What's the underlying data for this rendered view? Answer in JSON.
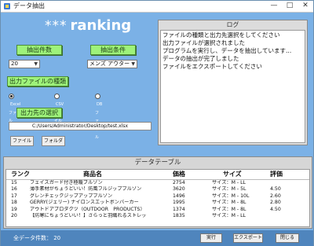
{
  "window": {
    "title": "データ抽出",
    "minimize": "—",
    "maximize": "□",
    "close": "✕"
  },
  "heading": {
    "stars": "***",
    "word": "ranking"
  },
  "extract": {
    "count_label": "抽出件数",
    "condition_label": "抽出条件",
    "count_value": "20",
    "condition_value": "メンズ アウター"
  },
  "output": {
    "type_label": "出力ファイルの種類",
    "options": [
      "Excelファイル",
      "CSVファイル",
      "DBファイル"
    ],
    "selected": 0,
    "dest_label": "出力先の選択",
    "path": "C:/Users/Administrator/Desktop/test.xlsx",
    "file_button": "ファイル",
    "folder_button": "フォルダ"
  },
  "log": {
    "title": "ログ",
    "lines": [
      "ファイルの種類と出力先選択をしてください",
      "出力ファイルが選択されました",
      "プログラムを実行し、データを抽出しています...",
      "データの抽出が完了しました",
      "ファイルをエクスポートしてください"
    ]
  },
  "table": {
    "title": "データテーブル",
    "headers": [
      "ランク",
      "商品名",
      "価格",
      "サイズ",
      "評価"
    ],
    "rows": [
      [
        "15",
        "フェイスガード付き極暖ブルゾン",
        "2754",
        "サイズ：M - LL",
        ""
      ],
      [
        "16",
        "薄手素材がちょうどいい！防風フルジップブルゾン",
        "3620",
        "サイズ：M - 5L",
        "4.50"
      ],
      [
        "17",
        "グレンチェックジップアップブルゾン",
        "1496",
        "サイズ：M - 10L",
        "2.60"
      ],
      [
        "18",
        "GERRY(ジェリー) ナイロンスエットボンバーカー",
        "1995",
        "サイズ：M - 8L",
        "2.80"
      ],
      [
        "19",
        "アウトドアプロダクツ（OUTDOOR　PRODUCTS）",
        "1374",
        "サイズ：M - 8L",
        "4.50"
      ],
      [
        "20",
        "【防寒にちょうどいい！】さらっと羽織れるストレッ",
        "1835",
        "サイズ：M - LL",
        ""
      ]
    ]
  },
  "footer": {
    "count_text": "全データ件数： 20",
    "run_button": "実行",
    "export_button": "エクスポート",
    "close_button": "閉じる"
  }
}
